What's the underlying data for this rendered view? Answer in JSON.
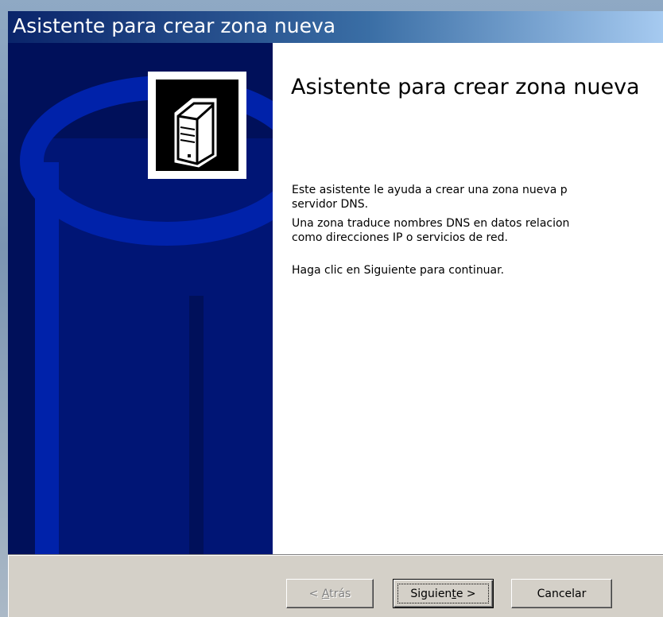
{
  "window": {
    "title": "Asistente para crear zona nueva"
  },
  "wizard": {
    "heading": "Asistente para crear zona nueva",
    "paragraph1": "Este asistente le ayuda a crear una zona nueva para el servidor DNS.",
    "paragraph1_line1": "Este asistente le ayuda a crear una zona nueva p",
    "paragraph1_line2": "servidor DNS.",
    "paragraph2_line1": "Una zona traduce nombres DNS en datos relacion",
    "paragraph2_line2": "como direcciones IP o servicios de red.",
    "paragraph3": "Haga clic en Siguiente para continuar."
  },
  "buttons": {
    "back_prefix": "< ",
    "back_access_key": "A",
    "back_rest": "trás",
    "next_prefix": "Siguien",
    "next_access_key": "t",
    "next_rest": "e >",
    "cancel": "Cancelar"
  },
  "icons": {
    "side_graphic": "database-cylinder-graphic",
    "server": "server-icon"
  },
  "colors": {
    "title_bar_start": "#0a246a",
    "title_bar_end": "#a6caf0",
    "side_panel": "#00105a",
    "dialog_face": "#d4d0c8"
  }
}
